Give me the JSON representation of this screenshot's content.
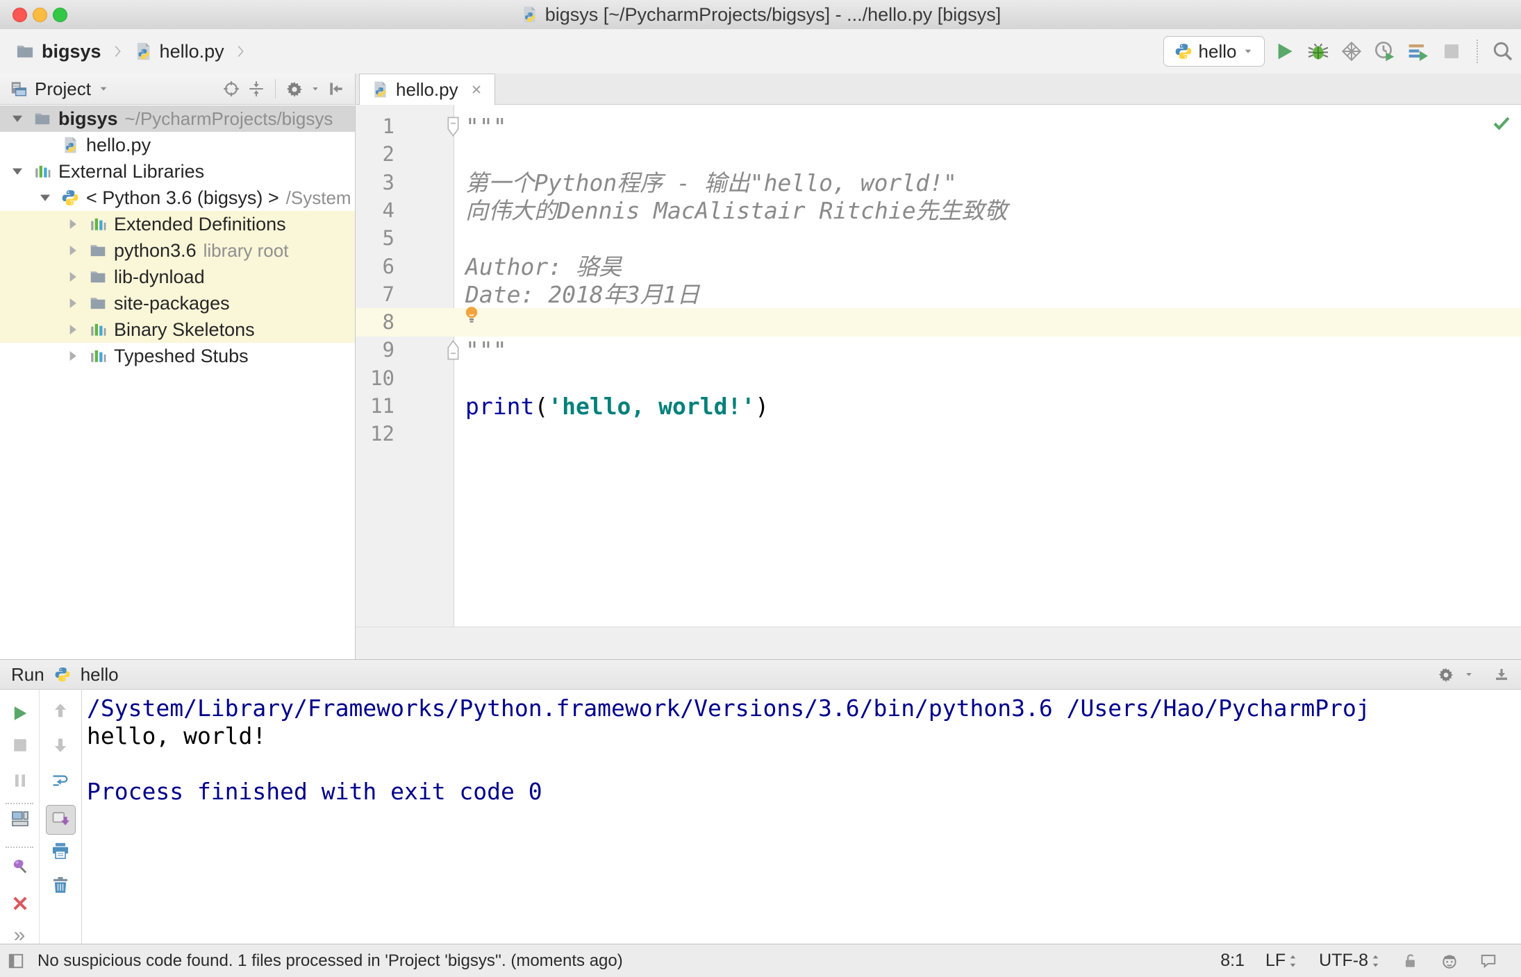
{
  "colors": {
    "accent_green": "#59a869",
    "selection_gray": "#d5d5d5",
    "library_highlight": "#faf6d8",
    "caret_line": "#fcf9e4",
    "keyword": "#00009b",
    "string": "#00807a",
    "docstring": "#8a8a8a",
    "console_system": "#00008b"
  },
  "title_bar": {
    "title": "bigsys [~/PycharmProjects/bigsys] - .../hello.py [bigsys]",
    "icon": "pyfile"
  },
  "nav": {
    "breadcrumbs": [
      {
        "label": "bigsys",
        "icon": "folder"
      },
      {
        "label": "hello.py",
        "icon": "pyfile"
      }
    ],
    "run_config": {
      "label": "hello",
      "icon": "python"
    },
    "actions": [
      {
        "name": "run",
        "icon": "play"
      },
      {
        "name": "debug",
        "icon": "debug"
      },
      {
        "name": "run-with-coverage",
        "icon": "coverage"
      },
      {
        "name": "profile",
        "icon": "profiler"
      },
      {
        "name": "concurrency-diagram",
        "icon": "concurrency"
      },
      {
        "name": "stop",
        "icon": "stop"
      }
    ],
    "search": {
      "name": "search-everywhere",
      "icon": "search"
    }
  },
  "project": {
    "header": {
      "title": "Project",
      "icons": [
        "target",
        "collapse",
        "gear",
        "hide-left"
      ]
    },
    "tree": [
      {
        "level": 0,
        "arrow": "expanded",
        "icon": "folder",
        "label": "bigsys",
        "bold": true,
        "suffix": "~/PycharmProjects/bigsys",
        "selected": true
      },
      {
        "level": 1,
        "arrow": "none",
        "icon": "pyfile",
        "label": "hello.py"
      },
      {
        "level": 0,
        "arrow": "expanded",
        "icon": "lib",
        "label": "External Libraries"
      },
      {
        "level": 1,
        "arrow": "expanded",
        "icon": "python",
        "label": "< Python 3.6 (bigsys) >",
        "suffix": "/System"
      },
      {
        "level": 2,
        "arrow": "collapsed",
        "icon": "lib",
        "label": "Extended Definitions",
        "highlight": true
      },
      {
        "level": 2,
        "arrow": "collapsed",
        "icon": "folder",
        "label": "python3.6",
        "suffix": "library root",
        "highlight": true
      },
      {
        "level": 2,
        "arrow": "collapsed",
        "icon": "folder",
        "label": "lib-dynload",
        "highlight": true
      },
      {
        "level": 2,
        "arrow": "collapsed",
        "icon": "folder",
        "label": "site-packages",
        "highlight": true
      },
      {
        "level": 2,
        "arrow": "collapsed",
        "icon": "lib",
        "label": "Binary Skeletons",
        "highlight": true
      },
      {
        "level": 2,
        "arrow": "collapsed",
        "icon": "lib",
        "label": "Typeshed Stubs"
      }
    ]
  },
  "editor": {
    "tab": {
      "label": "hello.py",
      "icon": "pyfile"
    },
    "inspection_status": "ok",
    "lines": [
      {
        "n": 1,
        "fold": "start",
        "segments": [
          {
            "t": "\"\"\"",
            "c": "doc"
          }
        ]
      },
      {
        "n": 2,
        "segments": []
      },
      {
        "n": 3,
        "segments": [
          {
            "t": "第一个Python程序 - 输出\"hello, world!\"",
            "c": "doc"
          }
        ]
      },
      {
        "n": 4,
        "segments": [
          {
            "t": "向伟大的Dennis MacAlistair Ritchie先生致敬",
            "c": "doc"
          }
        ]
      },
      {
        "n": 5,
        "segments": []
      },
      {
        "n": 6,
        "segments": [
          {
            "t": "Author: 骆昊",
            "c": "doc"
          }
        ]
      },
      {
        "n": 7,
        "segments": [
          {
            "t": "Date: 2018年3月1日",
            "c": "doc"
          }
        ],
        "bulb": true
      },
      {
        "n": 8,
        "segments": [],
        "caret": true
      },
      {
        "n": 9,
        "fold": "end",
        "segments": [
          {
            "t": "\"\"\"",
            "c": "doc"
          }
        ]
      },
      {
        "n": 10,
        "segments": []
      },
      {
        "n": 11,
        "segments": [
          {
            "t": "print",
            "c": "kw"
          },
          {
            "t": "(",
            "c": "plain"
          },
          {
            "t": "'hello, world!'",
            "c": "str"
          },
          {
            "t": ")",
            "c": "plain"
          }
        ]
      },
      {
        "n": 12,
        "segments": []
      }
    ]
  },
  "run": {
    "title": "Run",
    "config": "hello",
    "config_icon": "python",
    "header_icons": [
      "gear",
      "hide-down"
    ],
    "toolbar_left": [
      "rerun",
      "stop",
      "pause",
      "sep",
      "layout",
      "sep",
      "pin",
      "close",
      "more"
    ],
    "toolbar_inner": [
      "up",
      "down",
      "softwrap",
      "scrollend",
      "printer",
      "trash"
    ],
    "console": [
      {
        "text": "/System/Library/Frameworks/Python.framework/Versions/3.6/bin/python3.6 /Users/Hao/PycharmProj",
        "color": "system"
      },
      {
        "text": "hello, world!",
        "color": "stdout"
      },
      {
        "text": "",
        "color": "stdout"
      },
      {
        "text": "Process finished with exit code 0",
        "color": "system"
      }
    ]
  },
  "status": {
    "message": "No suspicious code found. 1 files processed in 'Project 'bigsys''. (moments ago)",
    "caret_position": "8:1",
    "line_separator": "LF",
    "encoding": "UTF-8",
    "icons": [
      "toolwin",
      "lock",
      "hector",
      "bubble"
    ]
  }
}
